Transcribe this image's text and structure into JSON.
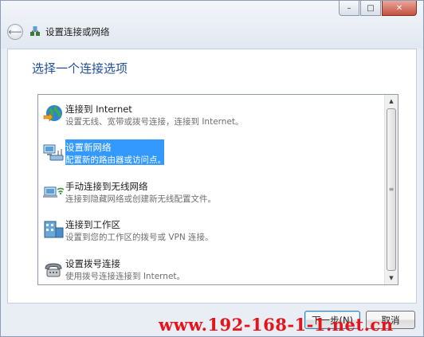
{
  "window": {
    "title": "设置连接或网络",
    "controls": {
      "minimize": "–",
      "maximize": "□",
      "close": "✕"
    }
  },
  "nav": {
    "back_icon": "back-arrow-icon",
    "back_glyph": "⟵",
    "app_icon": "network-setup-icon"
  },
  "page": {
    "heading": "选择一个连接选项"
  },
  "options": [
    {
      "title": "连接到 Internet",
      "description": "设置无线、宽带或拨号连接，连接到 Internet。",
      "icon": "internet-globe-icon",
      "selected": false
    },
    {
      "title": "设置新网络",
      "description": "配置新的路由器或访问点。",
      "icon": "new-network-icon",
      "selected": true
    },
    {
      "title": "手动连接到无线网络",
      "description": "连接到隐藏网络或创建新无线配置文件。",
      "icon": "wireless-network-icon",
      "selected": false
    },
    {
      "title": "连接到工作区",
      "description": "设置到您的工作区的拨号或 VPN 连接。",
      "icon": "workplace-icon",
      "selected": false
    },
    {
      "title": "设置拨号连接",
      "description": "使用拨号连接连接到 Internet。",
      "icon": "dialup-phone-icon",
      "selected": false
    }
  ],
  "scrollbar": {
    "up_glyph": "▲",
    "down_glyph": "▼",
    "grip_glyph": "≡"
  },
  "footer": {
    "next_label": "下一步(N)",
    "cancel_label": "取消"
  },
  "watermark": "www.192-168-1-1.net.cn",
  "colors": {
    "heading": "#1f4e9c",
    "selection": "#3399ff",
    "watermark": "#e8121a"
  }
}
